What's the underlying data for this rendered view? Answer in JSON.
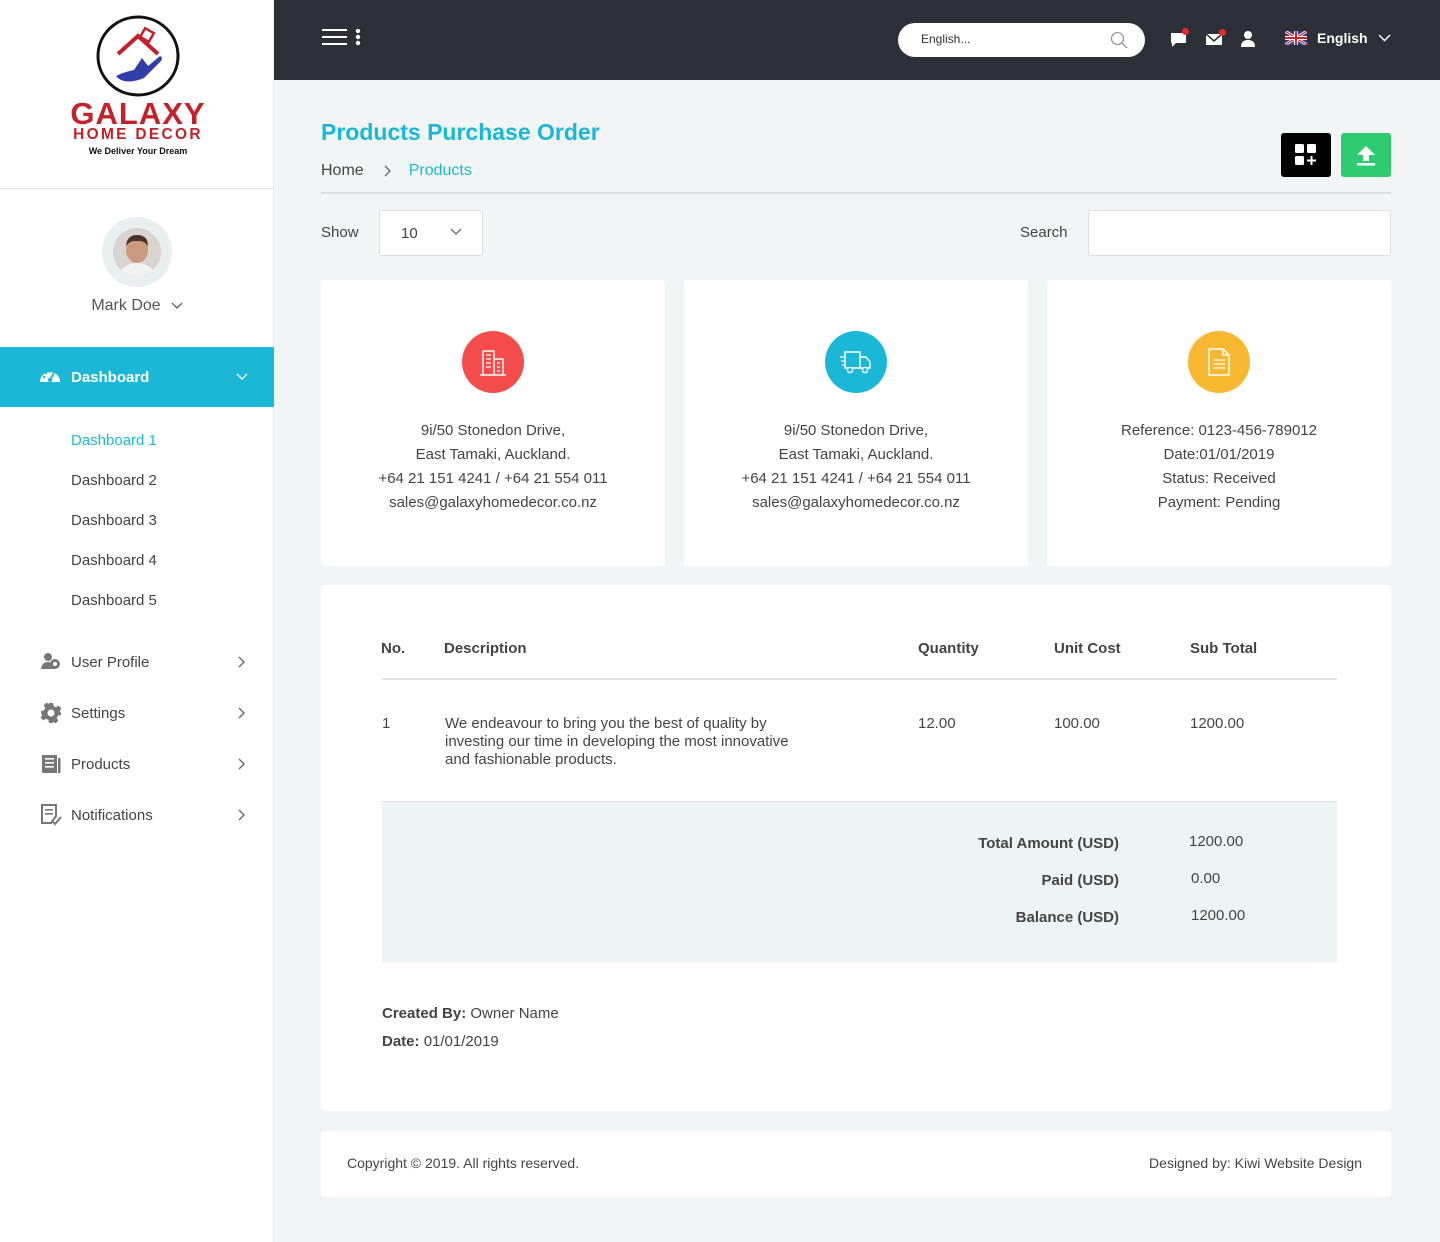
{
  "brand": {
    "name": "GALAXY",
    "sub": "HOME DECOR",
    "tagline": "We Deliver Your Dream",
    "accent": "#1ab8d6",
    "logo_red": "#c4222a"
  },
  "user": {
    "name": "Mark Doe"
  },
  "sidebar": {
    "active": {
      "label": "Dashboard",
      "icon": "dashboard-gauge-icon"
    },
    "subitems": [
      "Dashboard 1",
      "Dashboard 2",
      "Dashboard 3",
      "Dashboard 4",
      "Dashboard 5"
    ],
    "items": [
      {
        "label": "User Profile",
        "icon": "users-icon"
      },
      {
        "label": "Settings",
        "icon": "gear-icon"
      },
      {
        "label": "Products",
        "icon": "document-list-icon"
      },
      {
        "label": "Notifications",
        "icon": "notification-list-icon"
      }
    ]
  },
  "topbar": {
    "search_placeholder": "English...",
    "language": "English",
    "bg": "#2d3039"
  },
  "page": {
    "title": "Products Purchase Order",
    "breadcrumb": {
      "home": "Home",
      "current": "Products"
    }
  },
  "controls": {
    "show_label": "Show",
    "show_value": "10",
    "search_label": "Search"
  },
  "cards": [
    {
      "icon": "building-icon",
      "color": "#f44b4b",
      "lines": [
        "9i/50 Stonedon Drive,",
        "East Tamaki, Auckland.",
        "+64 21 151 4241 / +64 21 554 011",
        "sales@galaxyhomedecor.co.nz"
      ]
    },
    {
      "icon": "delivery-truck-icon",
      "color": "#1ab8d6",
      "lines": [
        "9i/50 Stonedon Drive,",
        "East Tamaki, Auckland.",
        "+64 21 151 4241 / +64 21 554 011",
        "sales@galaxyhomedecor.co.nz"
      ]
    },
    {
      "icon": "document-icon",
      "color": "#f7b731",
      "lines": [
        "Reference: 0123-456-789012",
        "Date:01/01/2019",
        "Status: Received",
        "Payment: Pending"
      ]
    }
  ],
  "table": {
    "headers": {
      "no": "No.",
      "description": "Description",
      "quantity": "Quantity",
      "unit_cost": "Unit Cost",
      "sub_total": "Sub Total"
    },
    "rows": [
      {
        "no": "1",
        "description_lines": [
          "We endeavour to bring you the best of quality by",
          "investing our time in developing the most innovative",
          "and fashionable products."
        ],
        "quantity": "12.00",
        "unit_cost": "100.00",
        "sub_total": "1200.00"
      }
    ]
  },
  "totals": {
    "total_label": "Total Amount (USD)",
    "total_value": "1200.00",
    "paid_label": "Paid (USD)",
    "paid_value": "0.00",
    "balance_label": "Balance (USD)",
    "balance_value": "1200.00"
  },
  "meta": {
    "created_by_label": "Created By:",
    "created_by_value": "Owner Name",
    "date_label": "Date:",
    "date_value": "01/01/2019"
  },
  "footer": {
    "copyright": "Copyright © 2019. All rights reserved.",
    "designer": "Designed by: Kiwi Website Design"
  }
}
